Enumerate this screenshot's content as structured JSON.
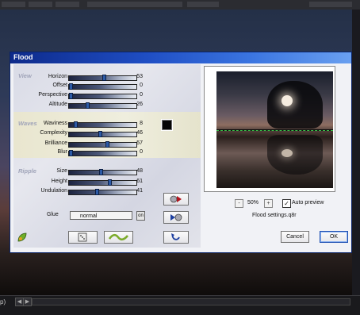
{
  "dialog": {
    "title": "Flood"
  },
  "groups": {
    "view": {
      "label": "View",
      "sliders": [
        {
          "label": "Horizon",
          "value": "53",
          "fraction": 0.53
        },
        {
          "label": "Offset",
          "value": "0",
          "fraction": 0.0
        },
        {
          "label": "Perspective",
          "value": "0",
          "fraction": 0.0
        },
        {
          "label": "Altitude",
          "value": "26",
          "fraction": 0.26
        }
      ]
    },
    "waves": {
      "label": "Waves",
      "sliders": [
        {
          "label": "Waviness",
          "value": "8",
          "fraction": 0.08
        },
        {
          "label": "Complexity",
          "value": "46",
          "fraction": 0.46
        },
        {
          "label": "Brilliance",
          "value": "57",
          "fraction": 0.57
        },
        {
          "label": "Blur",
          "value": "0",
          "fraction": 0.0
        }
      ]
    },
    "ripple": {
      "label": "Ripple",
      "sliders": [
        {
          "label": "Size",
          "value": "48",
          "fraction": 0.48
        },
        {
          "label": "Height",
          "value": "61",
          "fraction": 0.61
        },
        {
          "label": "Undulation",
          "value": "41",
          "fraction": 0.41
        }
      ]
    }
  },
  "glue": {
    "label": "Glue",
    "value": "normal",
    "button": "on"
  },
  "preview": {
    "zoom": "50%",
    "zoom_minus": "-",
    "zoom_plus": "+",
    "auto_preview_label": "Auto preview",
    "auto_preview_checked": true,
    "settings_file": "Flood settings.q8r"
  },
  "buttons": {
    "cancel": "Cancel",
    "ok": "OK"
  },
  "icons": {
    "leaf": "leaf-icon",
    "random": "dice-icon",
    "wave": "wave-icon",
    "preset_forward": "preset-forward-icon",
    "preset_back": "preset-back-icon",
    "reset": "reset-icon"
  },
  "host": {
    "status": "p)"
  },
  "colors": {
    "title_bar": "#1f4ec4",
    "waves_band": "#ece9d2",
    "slider_thumb": "#2c5aa6"
  }
}
